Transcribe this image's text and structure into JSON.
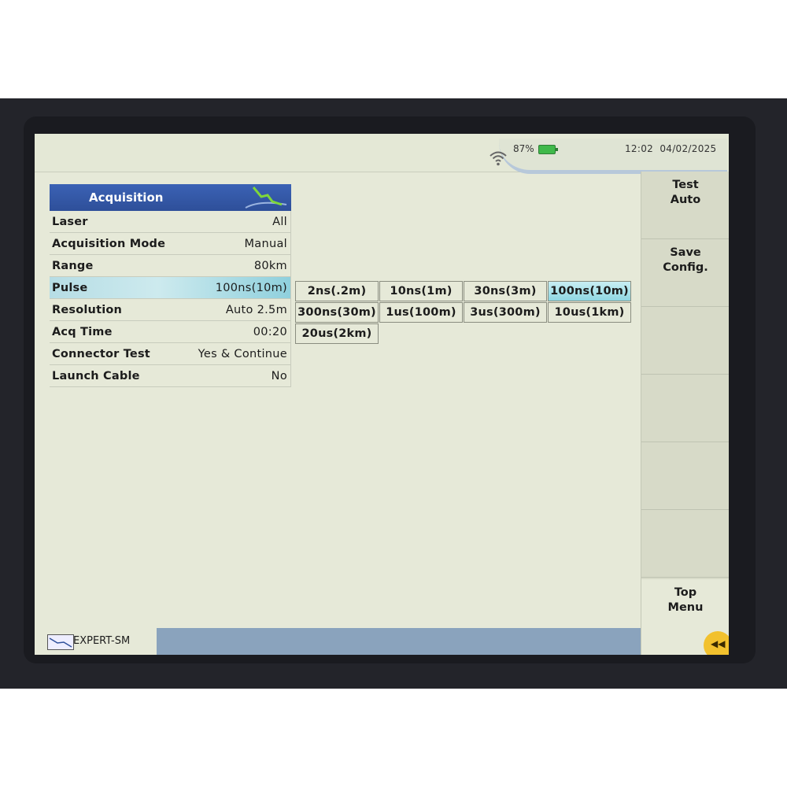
{
  "status": {
    "battery": "87%",
    "time": "12:02",
    "date": "04/02/2025"
  },
  "panel": {
    "title": "Acquisition",
    "rows": [
      {
        "label": "Laser",
        "value": "All"
      },
      {
        "label": "Acquisition Mode",
        "value": "Manual"
      },
      {
        "label": "Range",
        "value": "80km"
      },
      {
        "label": "Pulse",
        "value": "100ns(10m)"
      },
      {
        "label": "Resolution",
        "value": "Auto 2.5m"
      },
      {
        "label": "Acq Time",
        "value": "00:20"
      },
      {
        "label": "Connector Test",
        "value": "Yes & Continue"
      },
      {
        "label": "Launch Cable",
        "value": "No"
      }
    ]
  },
  "pulse_options": [
    "2ns(.2m)",
    "10ns(1m)",
    "30ns(3m)",
    "100ns(10m)",
    "300ns(30m)",
    "1us(100m)",
    "3us(300m)",
    "10us(1km)",
    "20us(2km)"
  ],
  "pulse_selected": "100ns(10m)",
  "softkeys": {
    "test": [
      "Test",
      "Auto"
    ],
    "save": [
      "Save",
      "Config."
    ],
    "top": [
      "Top",
      "Menu"
    ]
  },
  "bottom": {
    "mode": "EXPERT-SM"
  },
  "icons": {
    "wifi": "wifi-icon",
    "battery": "battery-icon",
    "trace": "trace-icon",
    "back": "back-arrows-icon"
  },
  "colors": {
    "title_bar": "#2e4f99",
    "selected": "#8fd7e2",
    "battery": "#3fb94a",
    "corner": "#f2c12e"
  }
}
